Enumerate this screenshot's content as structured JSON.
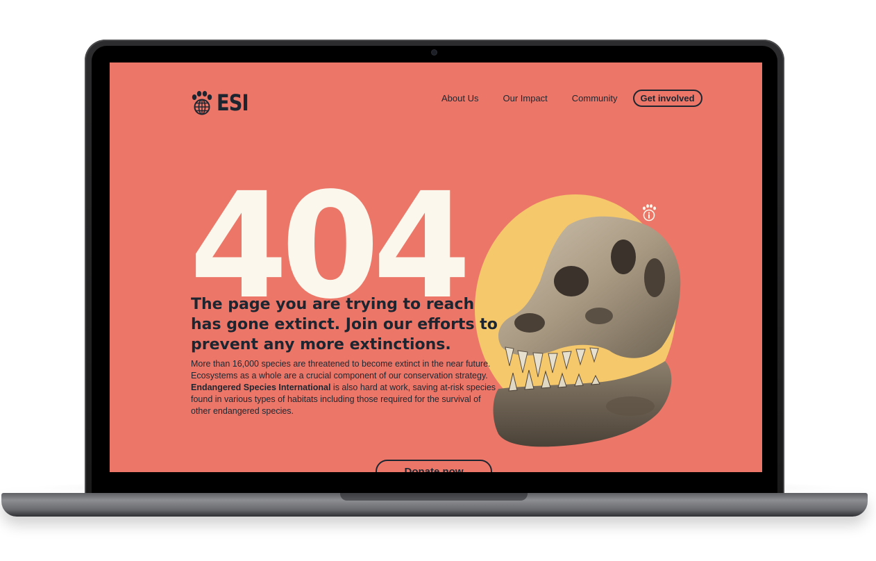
{
  "brand": {
    "name": "ESI"
  },
  "nav": {
    "items": [
      "About Us",
      "Our Impact",
      "Community"
    ],
    "cta": "Get involved"
  },
  "hero": {
    "code": "404",
    "headline": "The page you are trying to reach has gone extinct. Join our efforts to prevent any more extinctions.",
    "body_before": "More than 16,000 species are threatened to become extinct in the near future. Ecosystems as a whole are a crucial component of our conservation strategy. ",
    "body_bold": "Endangered Species International",
    "body_after": " is also hard at work, saving at-risk species found in various types of habitats including those required for the survival of other endangered species.",
    "donate_label": "Donate now"
  },
  "colors": {
    "background": "#ec7769",
    "accent_circle": "#f5c86b",
    "text": "#1d2630",
    "number": "#fbf7ec"
  },
  "icons": [
    "paw-globe-logo-icon",
    "paw-info-icon",
    "dinosaur-skull-image"
  ]
}
